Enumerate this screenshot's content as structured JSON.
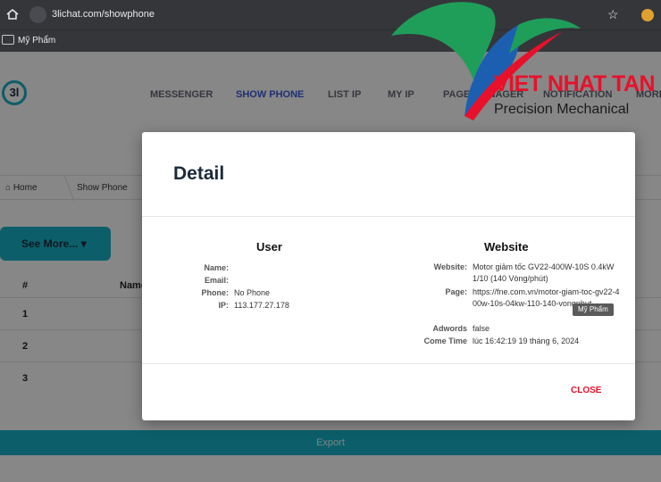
{
  "browser": {
    "url": "3lichat.com/showphone",
    "bookmark": "Mỹ Phẩm"
  },
  "app": {
    "logo_text": "3l",
    "nav": [
      "MESSENGER",
      "SHOW PHONE",
      "LIST IP",
      "MY IP",
      "PAGE MANAGER",
      "NOTIFICATION",
      "MORE"
    ],
    "active_nav": "SHOW PHONE",
    "breadcrumb": {
      "home": "Home",
      "current": "Show Phone"
    },
    "see_more": "See More...",
    "table": {
      "headers": [
        "#",
        "Name"
      ],
      "rows": [
        "1",
        "2",
        "3"
      ]
    },
    "export": "Export"
  },
  "modal": {
    "title": "Detail",
    "user": {
      "heading": "User",
      "name_label": "Name:",
      "email_label": "Email:",
      "phone_label": "Phone:",
      "phone_value": "No Phone",
      "ip_label": "IP:",
      "ip_value": "113.177.27.178"
    },
    "website": {
      "heading": "Website",
      "website_label": "Website:",
      "website_value": "Motor giảm tốc GV22-400W-10S 0.4kW 1/10 (140 Vòng/phút)",
      "page_label": "Page:",
      "page_value": "https://fne.com.vn/motor-giam-toc-gv22-400w-10s-04kw-110-140-vongphut",
      "adwords_label": "Adwords",
      "adwords_value": "false",
      "cometime_label": "Come Time",
      "cometime_value": "lúc 16:42:19 19 tháng 6, 2024"
    },
    "tooltip": "Mỹ Phẩm",
    "close": "CLOSE"
  },
  "watermark": {
    "name": "VIET NHAT TAN",
    "subtitle": "Precision Mechanical"
  },
  "colors": {
    "accent": "#18b3c8",
    "active_nav": "#3a5ad9",
    "close": "#e8102a",
    "brand_red": "#e8102a",
    "brand_green": "#1f9e5a",
    "brand_blue": "#1c5fb0"
  }
}
